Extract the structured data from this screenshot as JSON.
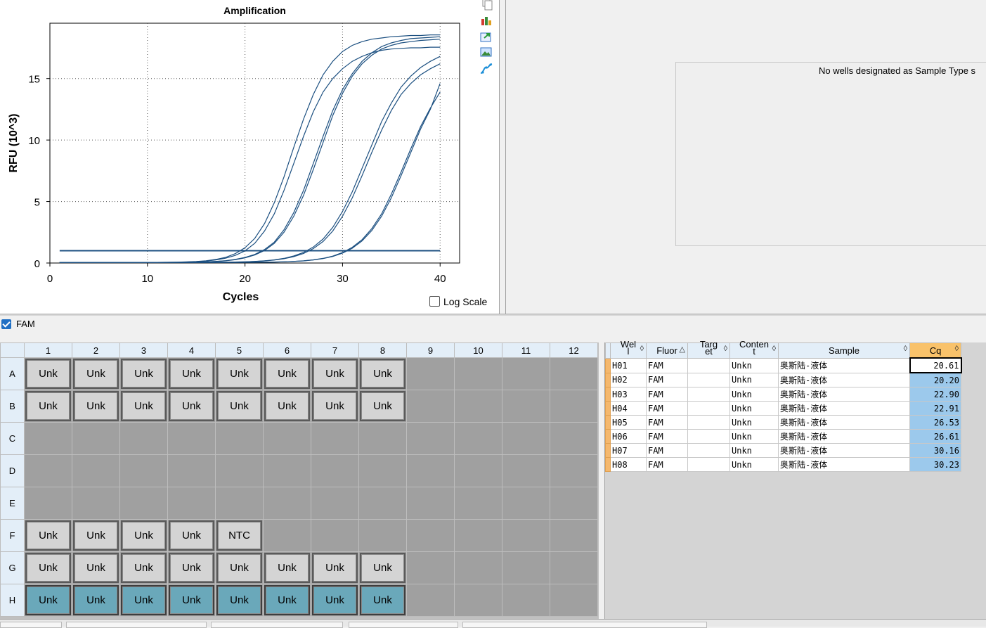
{
  "chart": {
    "toolbar_icons": [
      "copy-icon",
      "chart-settings-icon",
      "export-icon",
      "image-icon",
      "curve-icon"
    ],
    "log_scale_label": "Log Scale",
    "log_scale_checked": false
  },
  "chart_data": {
    "type": "line",
    "title": "Amplification",
    "xlabel": "Cycles",
    "ylabel": "RFU (10^3)",
    "xlim": [
      0,
      42
    ],
    "ylim": [
      0,
      19.5
    ],
    "xticks": [
      0,
      10,
      20,
      30,
      40
    ],
    "yticks": [
      0,
      5,
      10,
      15
    ],
    "grid": true,
    "line_color": "#1b4f80",
    "threshold": 1.0,
    "threshold_x": [
      1,
      40
    ],
    "x": [
      1,
      2,
      3,
      4,
      5,
      6,
      7,
      8,
      9,
      10,
      11,
      12,
      13,
      14,
      15,
      16,
      17,
      18,
      19,
      20,
      21,
      22,
      23,
      24,
      25,
      26,
      27,
      28,
      29,
      30,
      31,
      32,
      33,
      34,
      35,
      36,
      37,
      38,
      39,
      40
    ],
    "series": [
      {
        "values": [
          0.05,
          0.05,
          0.05,
          0.05,
          0.05,
          0.05,
          0.05,
          0.05,
          0.05,
          0.05,
          0.05,
          0.06,
          0.07,
          0.09,
          0.12,
          0.18,
          0.29,
          0.46,
          0.76,
          1.24,
          2.0,
          3.2,
          4.9,
          7.0,
          9.4,
          11.7,
          13.7,
          15.3,
          16.4,
          17.2,
          17.7,
          18.0,
          18.2,
          18.3,
          18.4,
          18.45,
          18.5,
          18.5,
          18.55,
          18.55
        ]
      },
      {
        "values": [
          0.05,
          0.05,
          0.05,
          0.05,
          0.05,
          0.05,
          0.05,
          0.05,
          0.05,
          0.05,
          0.05,
          0.06,
          0.06,
          0.08,
          0.11,
          0.16,
          0.25,
          0.39,
          0.62,
          0.99,
          1.6,
          2.6,
          4.0,
          5.9,
          8.1,
          10.3,
          12.3,
          13.9,
          15.0,
          15.8,
          16.4,
          16.8,
          17.1,
          17.3,
          17.4,
          17.45,
          17.5,
          17.5,
          17.55,
          17.55
        ]
      },
      {
        "values": [
          0.05,
          0.05,
          0.05,
          0.05,
          0.05,
          0.05,
          0.05,
          0.05,
          0.05,
          0.05,
          0.05,
          0.05,
          0.06,
          0.06,
          0.07,
          0.09,
          0.13,
          0.19,
          0.29,
          0.45,
          0.7,
          1.1,
          1.7,
          2.7,
          4.1,
          5.9,
          8.1,
          10.3,
          12.4,
          14.1,
          15.4,
          16.4,
          17.1,
          17.6,
          17.9,
          18.1,
          18.25,
          18.3,
          18.35,
          18.4
        ]
      },
      {
        "values": [
          0.05,
          0.05,
          0.05,
          0.05,
          0.05,
          0.05,
          0.05,
          0.05,
          0.05,
          0.05,
          0.05,
          0.05,
          0.06,
          0.06,
          0.07,
          0.09,
          0.12,
          0.18,
          0.27,
          0.42,
          0.65,
          1.02,
          1.6,
          2.5,
          3.8,
          5.5,
          7.6,
          9.8,
          12.0,
          13.8,
          15.2,
          16.2,
          16.9,
          17.4,
          17.7,
          17.9,
          18.0,
          18.1,
          18.15,
          18.2
        ]
      },
      {
        "values": [
          0.05,
          0.05,
          0.05,
          0.05,
          0.05,
          0.05,
          0.05,
          0.05,
          0.05,
          0.05,
          0.05,
          0.05,
          0.05,
          0.05,
          0.05,
          0.06,
          0.06,
          0.07,
          0.08,
          0.1,
          0.13,
          0.18,
          0.26,
          0.38,
          0.57,
          0.86,
          1.3,
          1.95,
          2.9,
          4.2,
          5.8,
          7.7,
          9.6,
          11.5,
          13.0,
          14.3,
          15.2,
          15.9,
          16.4,
          16.8
        ]
      },
      {
        "values": [
          0.05,
          0.05,
          0.05,
          0.05,
          0.05,
          0.05,
          0.05,
          0.05,
          0.05,
          0.05,
          0.05,
          0.05,
          0.05,
          0.05,
          0.05,
          0.06,
          0.06,
          0.07,
          0.08,
          0.1,
          0.12,
          0.17,
          0.24,
          0.35,
          0.52,
          0.78,
          1.17,
          1.75,
          2.6,
          3.8,
          5.3,
          7.1,
          9.0,
          10.8,
          12.4,
          13.7,
          14.6,
          15.3,
          15.8,
          16.2
        ]
      },
      {
        "values": [
          0.05,
          0.05,
          0.05,
          0.05,
          0.05,
          0.05,
          0.05,
          0.05,
          0.05,
          0.05,
          0.05,
          0.05,
          0.05,
          0.05,
          0.05,
          0.05,
          0.05,
          0.05,
          0.05,
          0.06,
          0.06,
          0.07,
          0.08,
          0.1,
          0.13,
          0.18,
          0.26,
          0.38,
          0.56,
          0.85,
          1.28,
          1.9,
          2.8,
          4.0,
          5.6,
          7.4,
          9.3,
          11.1,
          12.6,
          13.9
        ]
      },
      {
        "values": [
          0.05,
          0.05,
          0.05,
          0.05,
          0.05,
          0.05,
          0.05,
          0.05,
          0.05,
          0.05,
          0.05,
          0.05,
          0.05,
          0.05,
          0.05,
          0.05,
          0.05,
          0.05,
          0.05,
          0.06,
          0.06,
          0.07,
          0.08,
          0.1,
          0.13,
          0.17,
          0.25,
          0.36,
          0.53,
          0.8,
          1.2,
          1.8,
          2.65,
          3.8,
          5.3,
          7.1,
          9.0,
          10.9,
          12.5,
          14.6
        ]
      }
    ]
  },
  "sample_panel": {
    "message": "No wells designated as Sample Type s"
  },
  "fluor": {
    "label": "FAM",
    "checked": true
  },
  "plate": {
    "columns": [
      "1",
      "2",
      "3",
      "4",
      "5",
      "6",
      "7",
      "8",
      "9",
      "10",
      "11",
      "12"
    ],
    "rows": [
      {
        "label": "A",
        "wells": [
          "Unk",
          "Unk",
          "Unk",
          "Unk",
          "Unk",
          "Unk",
          "Unk",
          "Unk",
          "",
          "",
          "",
          ""
        ]
      },
      {
        "label": "B",
        "wells": [
          "Unk",
          "Unk",
          "Unk",
          "Unk",
          "Unk",
          "Unk",
          "Unk",
          "Unk",
          "",
          "",
          "",
          ""
        ]
      },
      {
        "label": "C",
        "wells": [
          "",
          "",
          "",
          "",
          "",
          "",
          "",
          "",
          "",
          "",
          "",
          ""
        ]
      },
      {
        "label": "D",
        "wells": [
          "",
          "",
          "",
          "",
          "",
          "",
          "",
          "",
          "",
          "",
          "",
          ""
        ]
      },
      {
        "label": "E",
        "wells": [
          "",
          "",
          "",
          "",
          "",
          "",
          "",
          "",
          "",
          "",
          "",
          ""
        ]
      },
      {
        "label": "F",
        "wells": [
          "Unk",
          "Unk",
          "Unk",
          "Unk",
          "NTC",
          "",
          "",
          "",
          "",
          "",
          "",
          ""
        ]
      },
      {
        "label": "G",
        "wells": [
          "Unk",
          "Unk",
          "Unk",
          "Unk",
          "Unk",
          "Unk",
          "Unk",
          "Unk",
          "",
          "",
          "",
          ""
        ]
      },
      {
        "label": "H",
        "wells": [
          "Unk",
          "Unk",
          "Unk",
          "Unk",
          "Unk",
          "Unk",
          "Unk",
          "Unk",
          "",
          "",
          "",
          ""
        ],
        "selected": true
      }
    ]
  },
  "results": {
    "headers": [
      "Wel\nl",
      "Fluor",
      "Targ\net",
      "Conten\nt",
      "Sample",
      "Cq"
    ],
    "sort_glyphs": [
      "◊",
      "△",
      "◊",
      "◊",
      "◊",
      "◊"
    ],
    "rows": [
      {
        "well": "H01",
        "fluor": "FAM",
        "target": "",
        "content": "Unkn",
        "sample": "奥斯陆-液体",
        "cq": "20.61"
      },
      {
        "well": "H02",
        "fluor": "FAM",
        "target": "",
        "content": "Unkn",
        "sample": "奥斯陆-液体",
        "cq": "20.20"
      },
      {
        "well": "H03",
        "fluor": "FAM",
        "target": "",
        "content": "Unkn",
        "sample": "奥斯陆-液体",
        "cq": "22.90"
      },
      {
        "well": "H04",
        "fluor": "FAM",
        "target": "",
        "content": "Unkn",
        "sample": "奥斯陆-液体",
        "cq": "22.91"
      },
      {
        "well": "H05",
        "fluor": "FAM",
        "target": "",
        "content": "Unkn",
        "sample": "奥斯陆-液体",
        "cq": "26.53"
      },
      {
        "well": "H06",
        "fluor": "FAM",
        "target": "",
        "content": "Unkn",
        "sample": "奥斯陆-液体",
        "cq": "26.61"
      },
      {
        "well": "H07",
        "fluor": "FAM",
        "target": "",
        "content": "Unkn",
        "sample": "奥斯陆-液体",
        "cq": "30.16"
      },
      {
        "well": "H08",
        "fluor": "FAM",
        "target": "",
        "content": "Unkn",
        "sample": "奥斯陆-液体",
        "cq": "30.23"
      }
    ]
  }
}
